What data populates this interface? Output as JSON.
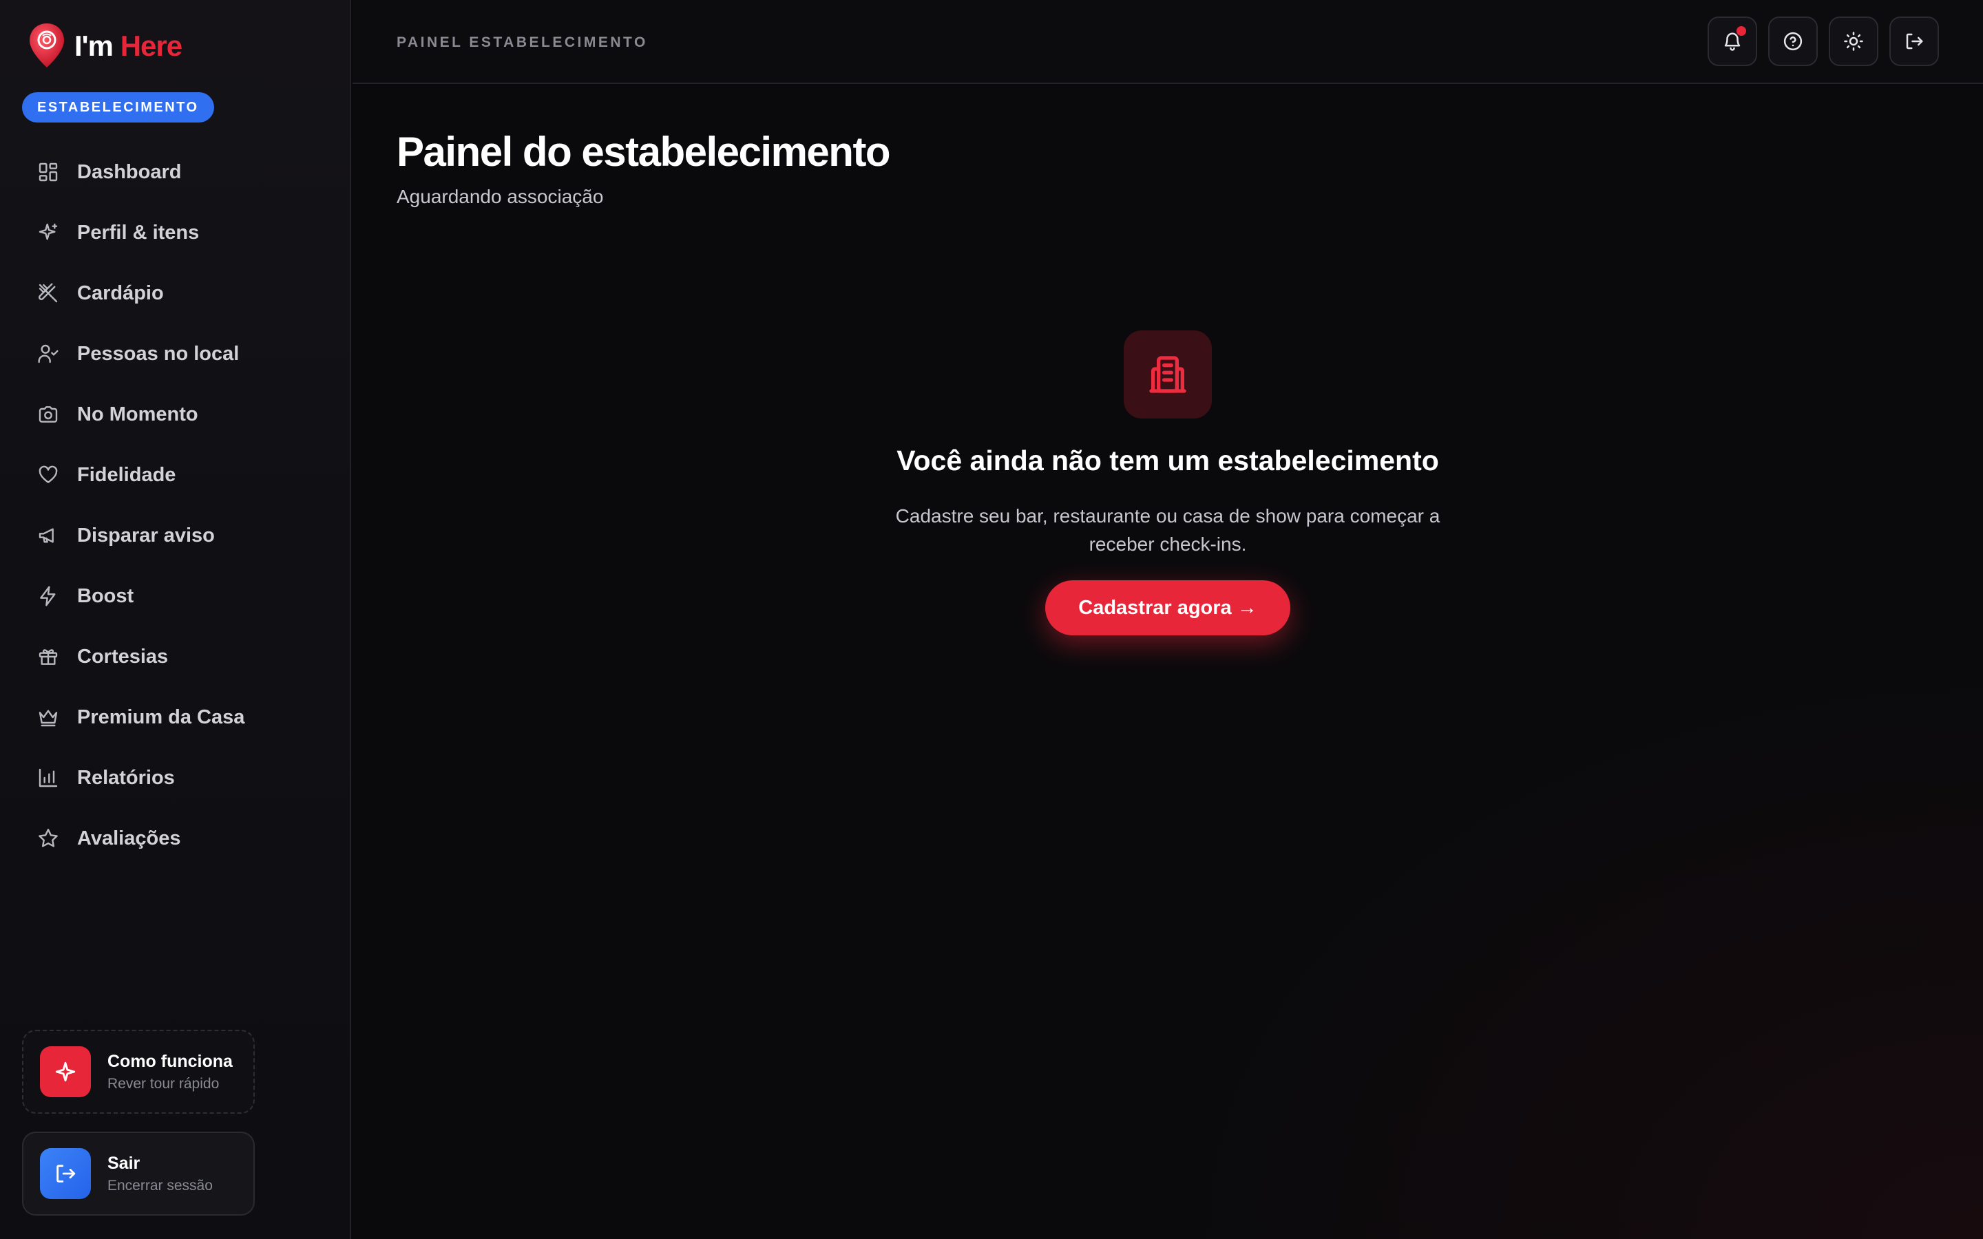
{
  "brand": {
    "name_part1": "I'm",
    "name_part2": "Here",
    "role_badge": "ESTABELECIMENTO",
    "accent_color": "#e8263a"
  },
  "sidebar": {
    "items": [
      {
        "label": "Dashboard",
        "icon": "grid-icon"
      },
      {
        "label": "Perfil & itens",
        "icon": "sparkles-icon"
      },
      {
        "label": "Cardápio",
        "icon": "utensils-crossed-icon"
      },
      {
        "label": "Pessoas no local",
        "icon": "user-check-icon"
      },
      {
        "label": "No Momento",
        "icon": "camera-icon"
      },
      {
        "label": "Fidelidade",
        "icon": "heart-icon"
      },
      {
        "label": "Disparar aviso",
        "icon": "megaphone-icon"
      },
      {
        "label": "Boost",
        "icon": "zap-icon"
      },
      {
        "label": "Cortesias",
        "icon": "gift-icon"
      },
      {
        "label": "Premium da Casa",
        "icon": "crown-icon"
      },
      {
        "label": "Relatórios",
        "icon": "bar-chart-icon"
      },
      {
        "label": "Avaliações",
        "icon": "star-icon"
      }
    ],
    "how_it_works": {
      "title": "Como funciona",
      "subtitle": "Rever tour rápido",
      "icon": "sparkle-icon"
    },
    "logout": {
      "title": "Sair",
      "subtitle": "Encerrar sessão",
      "icon": "logout-icon"
    }
  },
  "topbar": {
    "breadcrumb": "PAINEL ESTABELECIMENTO",
    "actions": [
      "bell-icon",
      "help-icon",
      "sun-icon",
      "logout-icon"
    ]
  },
  "main": {
    "title": "Painel do estabelecimento",
    "subtitle": "Aguardando associação",
    "empty_state": {
      "icon": "building-icon",
      "title": "Você ainda não tem um estabelecimento",
      "description": "Cadastre seu bar, restaurante ou casa de show para começar a receber check-ins.",
      "cta_label": "Cadastrar agora →"
    }
  }
}
